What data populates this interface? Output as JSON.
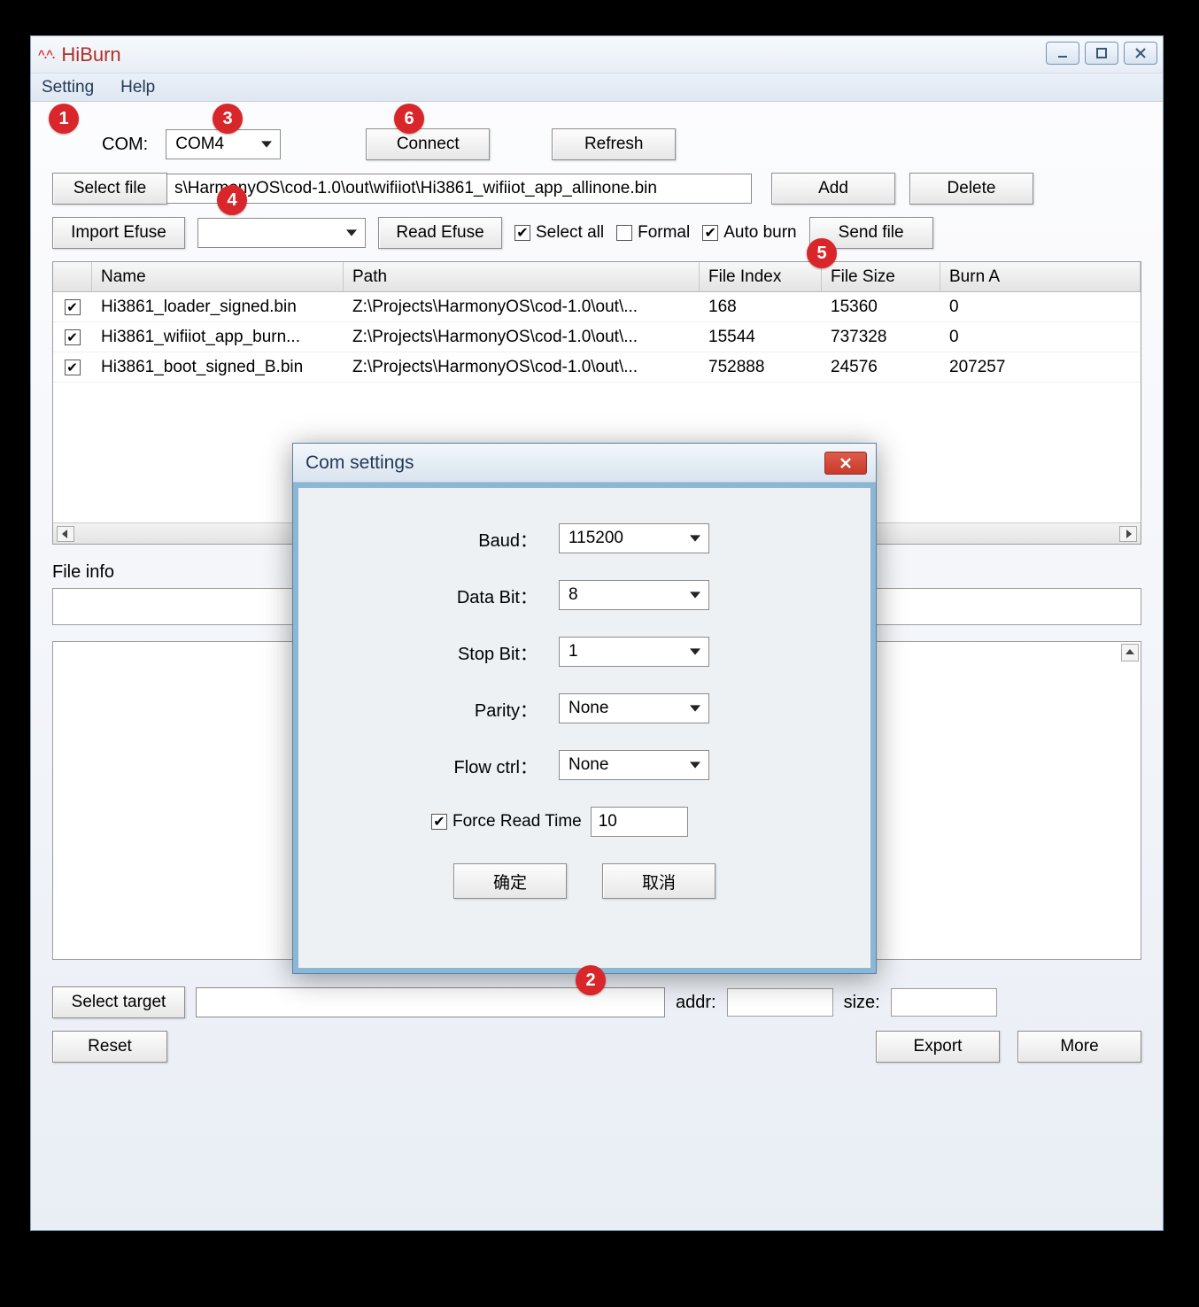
{
  "window": {
    "title": "HiBurn",
    "icon_text": "^.^."
  },
  "menu": {
    "setting": "Setting",
    "help": "Help"
  },
  "toolbar": {
    "com_label": "COM:",
    "com_value": "COM4",
    "connect": "Connect",
    "refresh": "Refresh",
    "select_file_btn": "Select file",
    "file_path": "s\\HarmonyOS\\cod-1.0\\out\\wifiiot\\Hi3861_wifiiot_app_allinone.bin",
    "add": "Add",
    "delete": "Delete",
    "import_efuse": "Import Efuse",
    "read_efuse": "Read Efuse",
    "select_all": "Select all",
    "formal": "Formal",
    "auto_burn": "Auto burn",
    "send_file": "Send file"
  },
  "checks": {
    "select_all": true,
    "formal": false,
    "auto_burn": true
  },
  "table": {
    "headers": {
      "name": "Name",
      "path": "Path",
      "index": "File Index",
      "size": "File Size",
      "addr": "Burn A"
    },
    "rows": [
      {
        "checked": true,
        "name": "Hi3861_loader_signed.bin",
        "path": "Z:\\Projects\\HarmonyOS\\cod-1.0\\out\\...",
        "index": "168",
        "size": "15360",
        "addr": "0"
      },
      {
        "checked": true,
        "name": "Hi3861_wifiiot_app_burn...",
        "path": "Z:\\Projects\\HarmonyOS\\cod-1.0\\out\\...",
        "index": "15544",
        "size": "737328",
        "addr": "0"
      },
      {
        "checked": true,
        "name": "Hi3861_boot_signed_B.bin",
        "path": "Z:\\Projects\\HarmonyOS\\cod-1.0\\out\\...",
        "index": "752888",
        "size": "24576",
        "addr": "207257"
      }
    ]
  },
  "fileinfo_label": "File info",
  "bottom": {
    "select_target": "Select target",
    "addr_label": "addr:",
    "size_label": "size:",
    "reset": "Reset",
    "export": "Export",
    "more": "More"
  },
  "dialog": {
    "title": "Com settings",
    "baud_label": "Baud：",
    "baud_value": "115200",
    "data_bit_label": "Data Bit：",
    "data_bit_value": "8",
    "stop_bit_label": "Stop Bit：",
    "stop_bit_value": "1",
    "parity_label": "Parity：",
    "parity_value": "None",
    "flow_label": "Flow ctrl：",
    "flow_value": "None",
    "force_read": "Force Read Time",
    "force_read_value": "10",
    "force_read_checked": true,
    "ok": "确定",
    "cancel": "取消"
  },
  "badges": {
    "b1": "1",
    "b2": "2",
    "b3": "3",
    "b4": "4",
    "b5": "5",
    "b6": "6"
  }
}
